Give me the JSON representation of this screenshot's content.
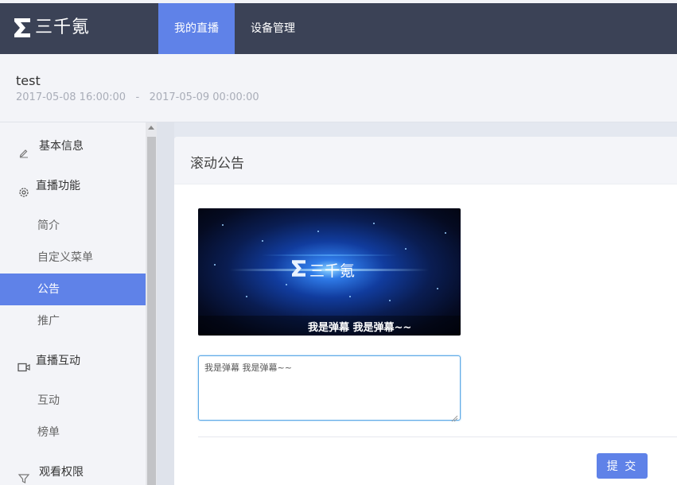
{
  "brand": {
    "name": "三千氪"
  },
  "nav": {
    "tabs": [
      {
        "label": "我的直播",
        "active": true
      },
      {
        "label": "设备管理",
        "active": false
      }
    ]
  },
  "event": {
    "title": "test",
    "start": "2017-05-08 16:00:00",
    "separator": "-",
    "end": "2017-05-09 00:00:00"
  },
  "sidebar": {
    "items": [
      {
        "label": "基本信息",
        "icon": "pencil-icon",
        "type": "group"
      },
      {
        "label": "直播功能",
        "icon": "gear-icon",
        "type": "group"
      },
      {
        "label": "简介",
        "type": "sub"
      },
      {
        "label": "自定义菜单",
        "type": "sub"
      },
      {
        "label": "公告",
        "type": "sub",
        "active": true
      },
      {
        "label": "推广",
        "type": "sub"
      },
      {
        "label": "直播互动",
        "icon": "video-icon",
        "type": "group"
      },
      {
        "label": "互动",
        "type": "sub"
      },
      {
        "label": "榜单",
        "type": "sub"
      },
      {
        "label": "观看权限",
        "icon": "filter-icon",
        "type": "group"
      }
    ]
  },
  "panel": {
    "title": "滚动公告",
    "preview_brand": "三千氪",
    "preview_danmu": "我是弹幕 我是弹幕~~",
    "textarea_value": "我是弹幕 我是弹幕~~",
    "submit_label": "提 交"
  },
  "colors": {
    "topbar": "#3b4256",
    "accent": "#5f82e8",
    "background": "#f3f4f8"
  }
}
